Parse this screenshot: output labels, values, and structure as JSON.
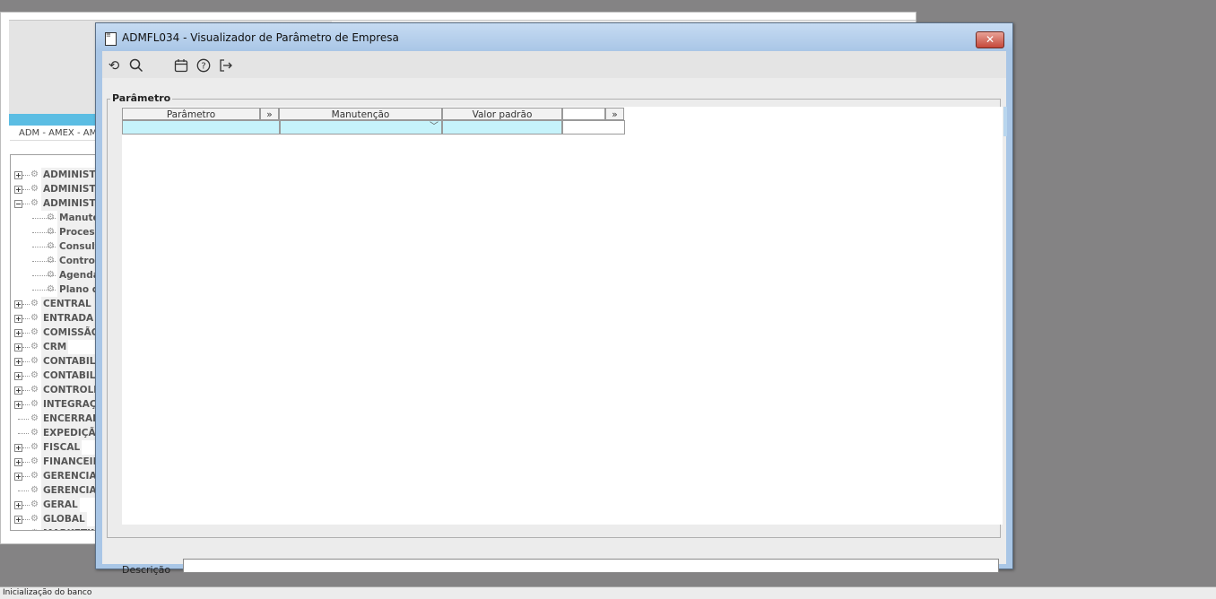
{
  "background_window": {
    "breadcrumb": "ADM - AMEX - AM",
    "tree": {
      "items": [
        {
          "label": "ADMINISTR",
          "expander": "+",
          "indent": 0
        },
        {
          "label": "ADMINISTR",
          "expander": "+",
          "indent": 0
        },
        {
          "label": "ADMINISTR",
          "expander": "−",
          "indent": 0
        },
        {
          "label": "Manuter",
          "expander": "",
          "indent": 1
        },
        {
          "label": "Process",
          "expander": "",
          "indent": 1
        },
        {
          "label": "Consult",
          "expander": "",
          "indent": 1
        },
        {
          "label": "Controle",
          "expander": "",
          "indent": 1
        },
        {
          "label": "Agenda",
          "expander": "",
          "indent": 1
        },
        {
          "label": "Plano de",
          "expander": "",
          "indent": 1
        },
        {
          "label": "CENTRAL D",
          "expander": "+",
          "indent": 0
        },
        {
          "label": "ENTRADA",
          "expander": "+",
          "indent": 0
        },
        {
          "label": "COMISSÃO",
          "expander": "+",
          "indent": 0
        },
        {
          "label": "CRM",
          "expander": "+",
          "indent": 0
        },
        {
          "label": "CONTABILI",
          "expander": "+",
          "indent": 0
        },
        {
          "label": "CONTABILI",
          "expander": "+",
          "indent": 0
        },
        {
          "label": "CONTROLE",
          "expander": "+",
          "indent": 0
        },
        {
          "label": "INTEGRAÇÃ",
          "expander": "+",
          "indent": 0
        },
        {
          "label": "ENCERRAM",
          "expander": "",
          "indent": 0
        },
        {
          "label": "EXPEDIÇÃO",
          "expander": "",
          "indent": 0
        },
        {
          "label": "FISCAL",
          "expander": "+",
          "indent": 0
        },
        {
          "label": "FINANCEIRO",
          "expander": "+",
          "indent": 0
        },
        {
          "label": "GERENCIAM",
          "expander": "+",
          "indent": 0
        },
        {
          "label": "GERENCIAD",
          "expander": "",
          "indent": 0
        },
        {
          "label": "GERAL",
          "expander": "+",
          "indent": 0
        },
        {
          "label": "GLOBAL",
          "expander": "+",
          "indent": 0
        },
        {
          "label": "MARKETING",
          "expander": "+",
          "indent": 0
        }
      ]
    }
  },
  "dialog": {
    "title": "ADMFL034 - Visualizador de Parâmetro de Empresa",
    "close_icon": "close-icon",
    "toolbar": {
      "buttons": [
        {
          "name": "refresh-icon",
          "glyph": "⟲"
        },
        {
          "name": "search-icon",
          "glyph": "🔍︎"
        },
        {
          "name": "calendar-icon",
          "glyph": "▦"
        },
        {
          "name": "help-icon",
          "glyph": "?"
        },
        {
          "name": "exit-icon",
          "glyph": "⇥"
        }
      ]
    },
    "group_label": "Parâmetro",
    "grid": {
      "columns": [
        {
          "label": "Parâmetro"
        },
        {
          "label": "»"
        },
        {
          "label": "Manutenção"
        },
        {
          "label": "Valor padrão"
        },
        {
          "label": ""
        },
        {
          "label": "»"
        }
      ],
      "rows": [
        {
          "parametro": "",
          "manutencao": "",
          "valor_padrao": "",
          "extra": ""
        }
      ]
    },
    "description_label": "Descrição",
    "description_value": ""
  },
  "status_text": "Inicialização do banco",
  "colors": {
    "dialog_frame": "#a9c6e6",
    "selected_cell": "#c6f3fb",
    "accent_bar": "#5bbde3",
    "close_button": "#c5483a"
  }
}
